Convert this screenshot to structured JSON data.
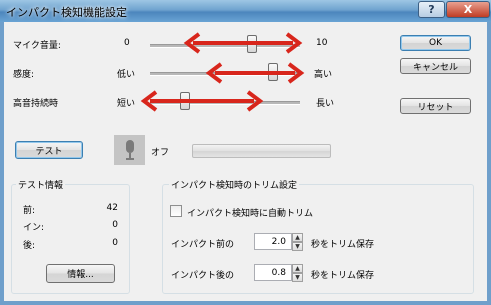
{
  "window": {
    "title": "インパクト検知機能設定",
    "help_label": "?",
    "close_label": "X"
  },
  "sliders": [
    {
      "label": "マイク音量:",
      "min_label": "0",
      "max_label": "10",
      "value": 0.68
    },
    {
      "label": "感度:",
      "min_label": "低い",
      "max_label": "高い",
      "value": 0.82
    },
    {
      "label": "高音持続時",
      "min_label": "短い",
      "max_label": "長い",
      "value": 0.23
    }
  ],
  "buttons": {
    "ok": "OK",
    "cancel": "キャンセル",
    "reset": "リセット",
    "test": "テスト",
    "info": "情報..."
  },
  "mic": {
    "status": "オフ",
    "level": 0
  },
  "test_info": {
    "title": "テスト情報",
    "rows": [
      {
        "label": "前:",
        "value": "42"
      },
      {
        "label": "イン:",
        "value": "0"
      },
      {
        "label": "後:",
        "value": "0"
      }
    ]
  },
  "trim": {
    "title": "インパクト検知時のトリム設定",
    "auto_trim_label": "インパクト検知時に自動トリム",
    "auto_trim_checked": false,
    "before_label": "インパクト前の",
    "before_value": "2.0",
    "before_suffix": "秒をトリム保存",
    "after_label": "インパクト後の",
    "after_value": "0.8",
    "after_suffix": "秒をトリム保存"
  },
  "colors": {
    "arrow": "#d8261c",
    "title_gradient": "#6fa3cf"
  },
  "icons": {
    "help": "help-icon",
    "close": "close-icon",
    "mic": "microphone-icon"
  }
}
